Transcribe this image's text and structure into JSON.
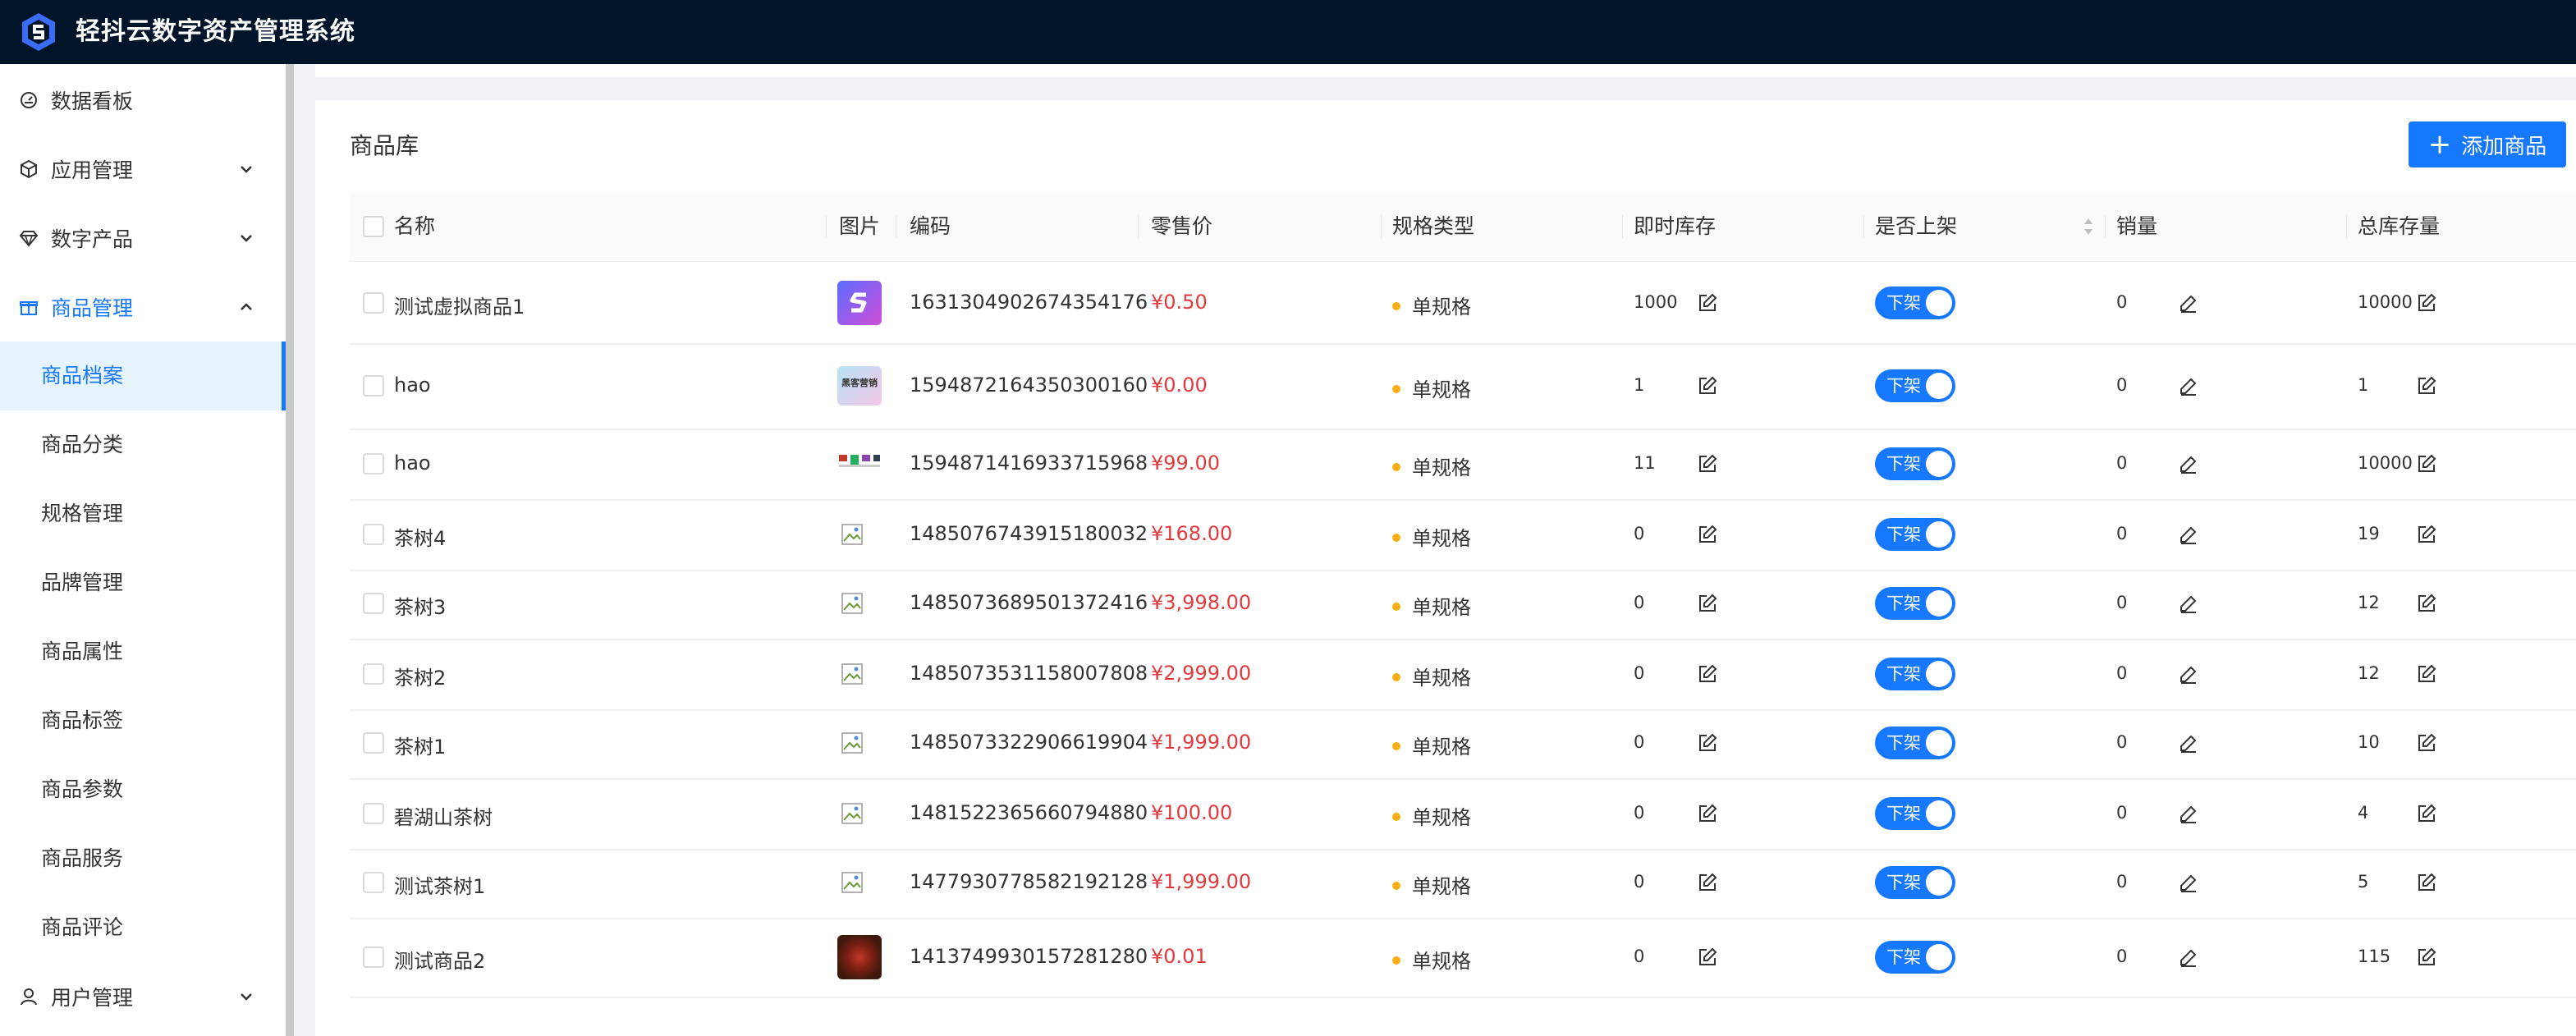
{
  "app": {
    "title": "轻抖云数字资产管理系统"
  },
  "sidebar": {
    "items": [
      {
        "label": "数据看板",
        "icon": "dashboard-icon"
      },
      {
        "label": "应用管理",
        "icon": "cube-icon"
      },
      {
        "label": "数字产品",
        "icon": "diamond-icon"
      },
      {
        "label": "商品管理",
        "icon": "gift-icon"
      },
      {
        "label": "用户管理",
        "icon": "user-icon"
      }
    ],
    "sub_items": [
      "商品档案",
      "商品分类",
      "规格管理",
      "品牌管理",
      "商品属性",
      "商品标签",
      "商品参数",
      "商品服务",
      "商品评论"
    ],
    "active_sub": "商品档案"
  },
  "main": {
    "title": "商品库",
    "add_button": "添加商品",
    "columns": {
      "name": "名称",
      "image": "图片",
      "code": "编码",
      "price": "零售价",
      "spec": "规格类型",
      "stock": "即时库存",
      "on_shelf": "是否上架",
      "sales": "销量",
      "total_stock": "总库存量"
    },
    "rows": [
      {
        "name": "测试虚拟商品1",
        "image": "logo",
        "code": "1631304902674354176",
        "price": "¥0.50",
        "spec": "单规格",
        "stock": "1000",
        "shelf": "下架",
        "sales": "0",
        "total": "10000"
      },
      {
        "name": "hao",
        "image": "banner",
        "banner_text": "黑客营销",
        "code": "1594872164350300160",
        "price": "¥0.00",
        "spec": "单规格",
        "stock": "1",
        "shelf": "下架",
        "sales": "0",
        "total": "1"
      },
      {
        "name": "hao",
        "image": "strip",
        "code": "1594871416933715968",
        "price": "¥99.00",
        "spec": "单规格",
        "stock": "11",
        "shelf": "下架",
        "sales": "0",
        "total": "10000"
      },
      {
        "name": "茶树4",
        "image": "broken",
        "code": "1485076743915180032",
        "price": "¥168.00",
        "spec": "单规格",
        "stock": "0",
        "shelf": "下架",
        "sales": "0",
        "total": "19"
      },
      {
        "name": "茶树3",
        "image": "broken",
        "code": "1485073689501372416",
        "price": "¥3,998.00",
        "spec": "单规格",
        "stock": "0",
        "shelf": "下架",
        "sales": "0",
        "total": "12"
      },
      {
        "name": "茶树2",
        "image": "broken",
        "code": "1485073531158007808",
        "price": "¥2,999.00",
        "spec": "单规格",
        "stock": "0",
        "shelf": "下架",
        "sales": "0",
        "total": "12"
      },
      {
        "name": "茶树1",
        "image": "broken",
        "code": "1485073322906619904",
        "price": "¥1,999.00",
        "spec": "单规格",
        "stock": "0",
        "shelf": "下架",
        "sales": "0",
        "total": "10"
      },
      {
        "name": "碧湖山茶树",
        "image": "broken",
        "code": "1481522365660794880",
        "price": "¥100.00",
        "spec": "单规格",
        "stock": "0",
        "shelf": "下架",
        "sales": "0",
        "total": "4"
      },
      {
        "name": "测试茶树1",
        "image": "broken",
        "code": "1477930778582192128",
        "price": "¥1,999.00",
        "spec": "单规格",
        "stock": "0",
        "shelf": "下架",
        "sales": "0",
        "total": "5"
      },
      {
        "name": "测试商品2",
        "image": "tea",
        "code": "1413749930157281280",
        "price": "¥0.01",
        "spec": "单规格",
        "stock": "0",
        "shelf": "下架",
        "sales": "0",
        "total": "115"
      }
    ]
  },
  "colors": {
    "topbar": "#001529",
    "accent": "#1677ff",
    "price": "#e4393c",
    "spec_dot": "#faad14"
  }
}
